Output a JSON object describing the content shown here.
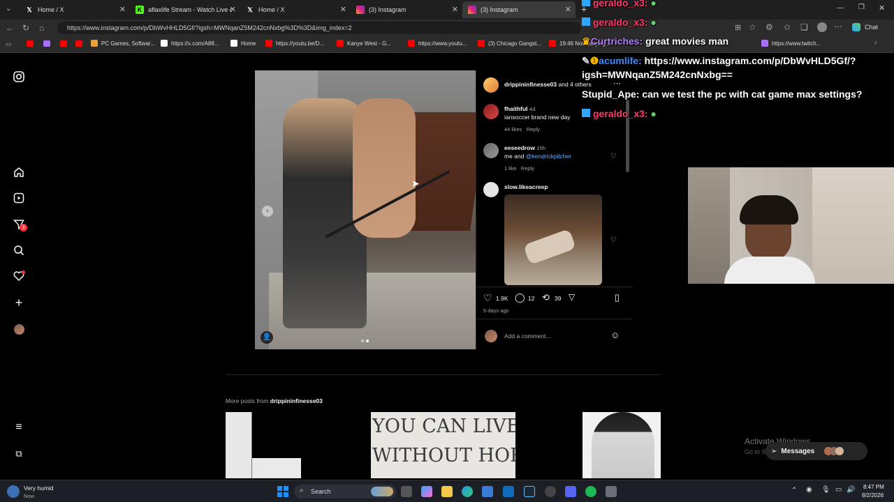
{
  "browser": {
    "tabs": [
      {
        "label": "Home / X",
        "icon": "x-logo-icon"
      },
      {
        "label": "aflaxlife Stream - Watch Live on K",
        "icon": "kick-logo-icon"
      },
      {
        "label": "Home / X",
        "icon": "x-logo-icon"
      },
      {
        "label": "(3) Instagram",
        "icon": "instagram-logo-icon"
      },
      {
        "label": "(3) Instagram",
        "icon": "instagram-logo-icon"
      }
    ],
    "url": "https://www.instagram.com/p/DbWvHHLD5Gf/?igsh=MWNqanZ5M242cnNxbg%3D%3D&img_index=2",
    "chat_label": "Chat",
    "bookmarks": [
      "PC Games, Softwar...",
      "https://x.com/A88...",
      "Home",
      "https://youtu.be/D...",
      "Kanye West - G...",
      "https://www.youtu...",
      "(3) Chicago Gangst...",
      "19:46 Now playing...",
      "https://www.twitch..."
    ]
  },
  "post": {
    "header_user": "drippininfinesse03",
    "header_suffix": "and 4 others",
    "comments": [
      {
        "user": "fhaithful",
        "age": "4d",
        "text": "iansoccer brand new day",
        "likes": "44 likes",
        "reply": "Reply"
      },
      {
        "user": "eeseedrow",
        "age": "15h",
        "text_prefix": "me and",
        "mention": "@kendrickpilcher",
        "likes": "1 like",
        "reply": "Reply"
      },
      {
        "user": "slow.likeacreep"
      }
    ],
    "like_count": "1.9K",
    "comment_count": "12",
    "repost_count": "39",
    "posted_ago": "5 days ago",
    "add_comment_placeholder": "Add a comment...",
    "more_posts_prefix": "More posts from",
    "more_posts_user": "drippininfinesse03",
    "grid_text_line1": "YOU CAN LIVE",
    "grid_text_line2": "WITHOUT HORSES"
  },
  "overlay_chat": [
    {
      "user": "geraldo_x3:",
      "text": "",
      "color": "#ff3b6b"
    },
    {
      "user": "geraldo_x3:",
      "text": "",
      "color": "#ff3b6b"
    },
    {
      "user": "Curtriches:",
      "text": "great movies man",
      "color": "#b57bff"
    },
    {
      "user": "acumlife:",
      "text": "https://www.instagram.com/p/DbWvHLD5Gf/?",
      "color": "#3b8bff"
    },
    {
      "user": "",
      "text": "igsh=MWNqanZ5M242cnNxbg==",
      "color": "#ffffff"
    },
    {
      "user": "Stupid_Ape:",
      "text": "can we test the pc with cat game max settings?",
      "color": "#ffffff"
    },
    {
      "user": "geraldo_x3:",
      "text": "",
      "color": "#ff3b6b"
    }
  ],
  "watermark": {
    "title": "Activate Windows",
    "sub": "Go to Settings to activate Windows."
  },
  "messages_label": "Messages",
  "notification_badge": "3",
  "taskbar": {
    "weather_title": "Very humid",
    "weather_sub": "Now",
    "search_label": "Search",
    "time": "8:47 PM",
    "date": "8/2/2026"
  }
}
